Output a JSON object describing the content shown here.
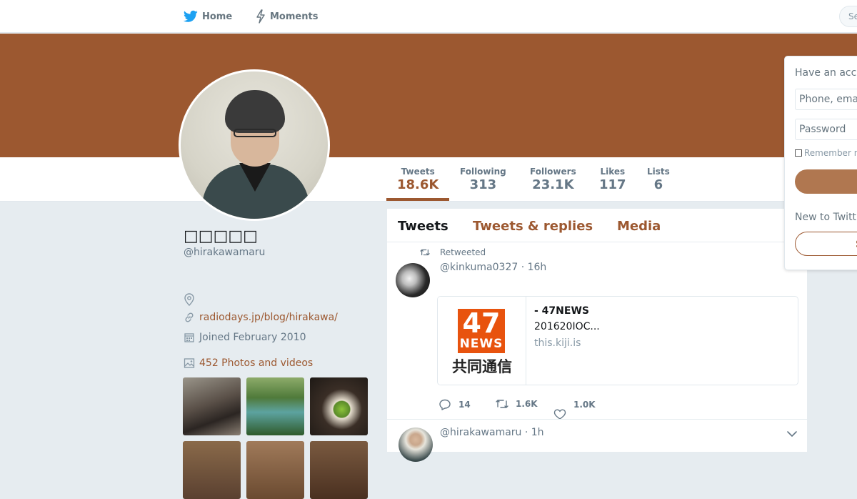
{
  "nav": {
    "home_label": "Home",
    "moments_label": "Moments",
    "search_placeholder": "Se"
  },
  "colors": {
    "accent": "#9c5830",
    "banner": "#9c5830"
  },
  "profile": {
    "name": "□□□□□",
    "handle": "@hirakawamaru",
    "website": "radiodays.jp/blog/hirakawa/",
    "joined": "Joined February 2010",
    "photos_label": "452 Photos and videos"
  },
  "stats": [
    {
      "label": "Tweets",
      "value": "18.6K"
    },
    {
      "label": "Following",
      "value": "313"
    },
    {
      "label": "Followers",
      "value": "23.1K"
    },
    {
      "label": "Likes",
      "value": "117"
    },
    {
      "label": "Lists",
      "value": "6"
    }
  ],
  "tabs": [
    "Tweets",
    "Tweets & replies",
    "Media"
  ],
  "tweets": [
    {
      "context": "Retweeted",
      "author": "@kinkuma0327 · 16h",
      "card": {
        "logo_number": "47",
        "logo_word": "NEWS",
        "logo_jp": "共同通信",
        "title": " -  47NEWS",
        "description": "201620IOC...",
        "url": "this.kiji.is"
      },
      "replies": "14",
      "retweets": "1.6K",
      "likes": "1.0K"
    },
    {
      "author": "@hirakawamaru · 1h"
    }
  ],
  "login": {
    "title": "Have an acc",
    "phone_placeholder": "Phone, ema",
    "password_placeholder": "Password",
    "remember": "Remember n",
    "new_to_twitter": "New to Twitt",
    "signup_label": "S"
  }
}
